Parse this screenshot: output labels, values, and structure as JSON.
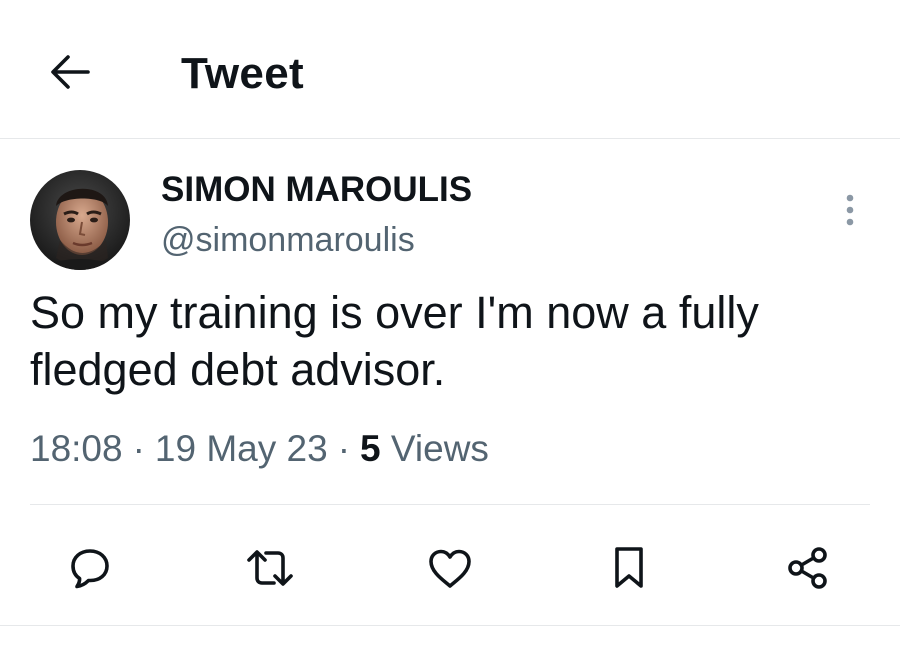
{
  "header": {
    "title": "Tweet",
    "back_icon": "arrow-left-icon"
  },
  "tweet": {
    "author": {
      "display_name": "SIMON MAROULIS",
      "handle": "@simonmaroulis"
    },
    "text": "So my training is over I'm now a fully fledged debt advisor.",
    "time": "18:08",
    "date": "19 May 23",
    "views_count": "5",
    "views_label": "Views",
    "separator": "·"
  },
  "actions": [
    {
      "icon": "reply-icon"
    },
    {
      "icon": "retweet-icon"
    },
    {
      "icon": "like-icon"
    },
    {
      "icon": "bookmark-icon"
    },
    {
      "icon": "share-icon"
    }
  ],
  "colors": {
    "text_primary": "#0f1419",
    "text_secondary": "#536471",
    "divider": "#e6e8ea"
  }
}
